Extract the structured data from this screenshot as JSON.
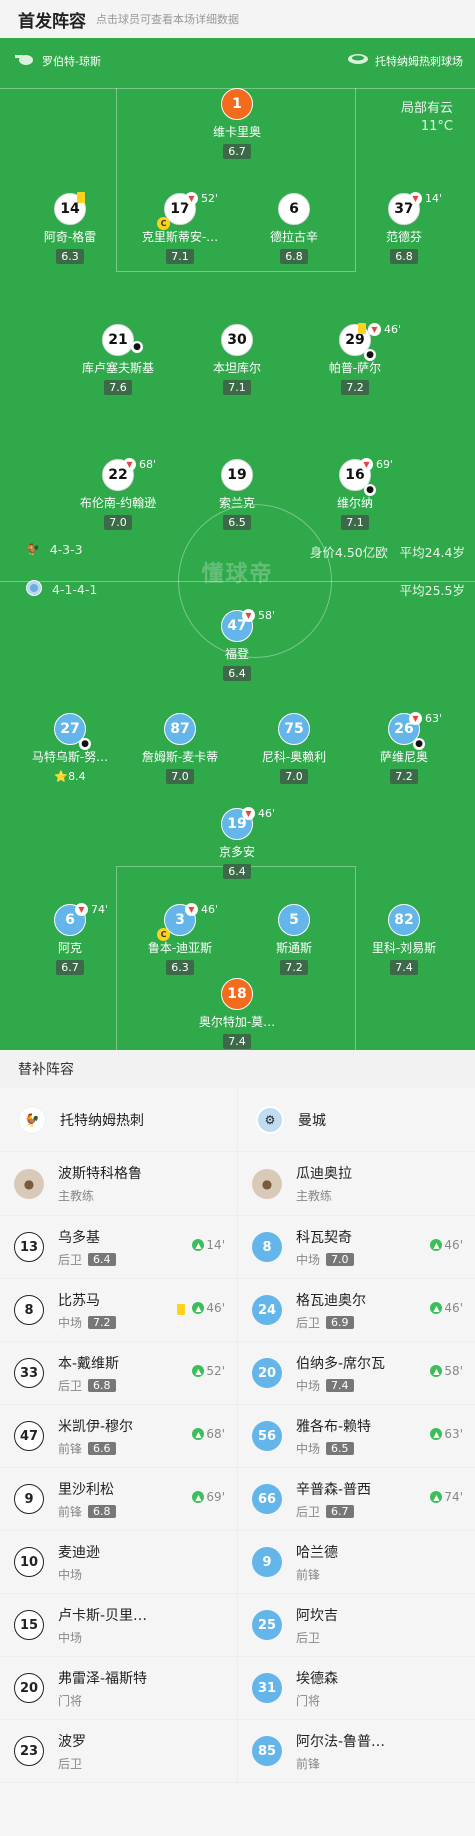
{
  "header": {
    "title": "首发阵容",
    "subtitle": "点击球员可查看本场详细数据"
  },
  "pitch": {
    "referee": "罗伯特-琼斯",
    "stadium": "托特纳姆热刺球场",
    "weather": "局部有云",
    "temperature": "11°C",
    "watermark": "懂球帝",
    "home": {
      "formation": "4-3-3",
      "value": "身价4.50亿欧",
      "avg_age": "平均24.4岁"
    },
    "away": {
      "formation": "4-1-4-1",
      "avg_age": "平均25.5岁"
    }
  },
  "home_players": [
    {
      "num": "1",
      "name": "维卡里奥",
      "rating": "6.7"
    },
    {
      "num": "14",
      "name": "阿奇-格雷",
      "rating": "6.3"
    },
    {
      "num": "17",
      "name": "克里斯蒂安-…",
      "rating": "7.1",
      "sub": "52'"
    },
    {
      "num": "6",
      "name": "德拉古辛",
      "rating": "6.8"
    },
    {
      "num": "37",
      "name": "范德芬",
      "rating": "6.8",
      "sub": "14'"
    },
    {
      "num": "21",
      "name": "库卢塞夫斯基",
      "rating": "7.6"
    },
    {
      "num": "30",
      "name": "本坦库尔",
      "rating": "7.1"
    },
    {
      "num": "29",
      "name": "帕普-萨尔",
      "rating": "7.2",
      "sub": "46'"
    },
    {
      "num": "22",
      "name": "布伦南-约翰逊",
      "rating": "7.0",
      "sub": "68'"
    },
    {
      "num": "19",
      "name": "索兰克",
      "rating": "6.5"
    },
    {
      "num": "16",
      "name": "维尔纳",
      "rating": "7.1",
      "sub": "69'"
    }
  ],
  "away_players": [
    {
      "num": "47",
      "name": "福登",
      "rating": "6.4",
      "sub": "58'"
    },
    {
      "num": "27",
      "name": "马特乌斯-努…",
      "rating": "8.4"
    },
    {
      "num": "87",
      "name": "詹姆斯-麦卡蒂",
      "rating": "7.0"
    },
    {
      "num": "75",
      "name": "尼科-奥赖利",
      "rating": "7.0"
    },
    {
      "num": "26",
      "name": "萨维尼奥",
      "rating": "7.2",
      "sub": "63'"
    },
    {
      "num": "19",
      "name": "京多安",
      "rating": "6.4",
      "sub": "46'"
    },
    {
      "num": "6",
      "name": "阿克",
      "rating": "6.7",
      "sub": "74'"
    },
    {
      "num": "3",
      "name": "鲁本-迪亚斯",
      "rating": "6.3",
      "sub": "46'"
    },
    {
      "num": "5",
      "name": "斯通斯",
      "rating": "7.2"
    },
    {
      "num": "82",
      "name": "里科-刘易斯",
      "rating": "7.4"
    },
    {
      "num": "18",
      "name": "奥尔特加-莫…",
      "rating": "7.4"
    }
  ],
  "subs": {
    "title": "替补阵容",
    "home": {
      "team": "托特纳姆热刺",
      "coach": "波斯特科格鲁",
      "coach_role": "主教练",
      "players": [
        {
          "num": "13",
          "name": "乌多基",
          "pos": "后卫",
          "rating": "6.4",
          "in": "14'"
        },
        {
          "num": "8",
          "name": "比苏马",
          "pos": "中场",
          "rating": "7.2",
          "in": "46'"
        },
        {
          "num": "33",
          "name": "本-戴维斯",
          "pos": "后卫",
          "rating": "6.8",
          "in": "52'"
        },
        {
          "num": "47",
          "name": "米凯伊-穆尔",
          "pos": "前锋",
          "rating": "6.6",
          "in": "68'"
        },
        {
          "num": "9",
          "name": "里沙利松",
          "pos": "前锋",
          "rating": "6.8",
          "in": "69'"
        },
        {
          "num": "10",
          "name": "麦迪逊",
          "pos": "中场"
        },
        {
          "num": "15",
          "name": "卢卡斯-贝里…",
          "pos": "中场"
        },
        {
          "num": "20",
          "name": "弗雷泽-福斯特",
          "pos": "门将"
        },
        {
          "num": "23",
          "name": "波罗",
          "pos": "后卫"
        }
      ]
    },
    "away": {
      "team": "曼城",
      "coach": "瓜迪奥拉",
      "coach_role": "主教练",
      "players": [
        {
          "num": "8",
          "name": "科瓦契奇",
          "pos": "中场",
          "rating": "7.0",
          "in": "46'"
        },
        {
          "num": "24",
          "name": "格瓦迪奥尔",
          "pos": "后卫",
          "rating": "6.9",
          "in": "46'"
        },
        {
          "num": "20",
          "name": "伯纳多-席尔瓦",
          "pos": "中场",
          "rating": "7.4",
          "in": "58'"
        },
        {
          "num": "56",
          "name": "雅各布-赖特",
          "pos": "中场",
          "rating": "6.5",
          "in": "63'"
        },
        {
          "num": "66",
          "name": "辛普森-普西",
          "pos": "后卫",
          "rating": "6.7",
          "in": "74'"
        },
        {
          "num": "9",
          "name": "哈兰德",
          "pos": "前锋"
        },
        {
          "num": "25",
          "name": "阿坎吉",
          "pos": "后卫"
        },
        {
          "num": "31",
          "name": "埃德森",
          "pos": "门将"
        },
        {
          "num": "85",
          "name": "阿尔法-鲁普…",
          "pos": "前锋"
        }
      ]
    }
  }
}
